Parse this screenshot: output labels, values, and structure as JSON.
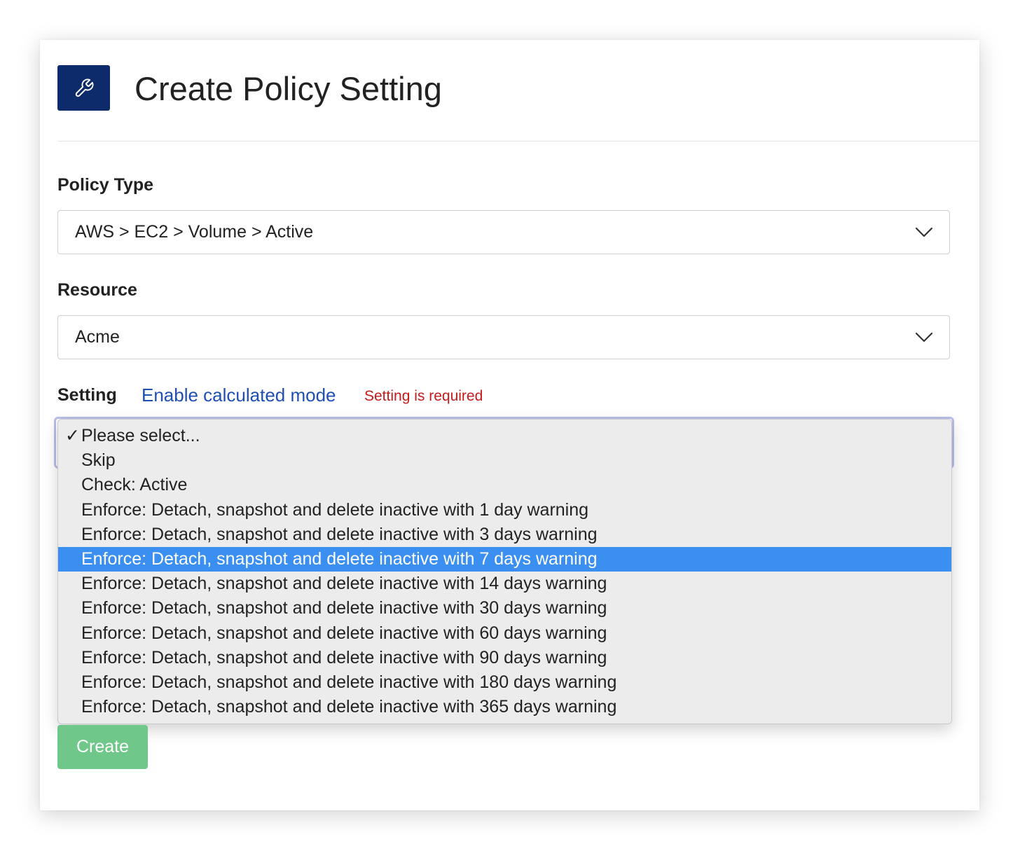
{
  "header": {
    "icon": "wrench-icon",
    "title": "Create Policy Setting"
  },
  "form": {
    "policy_type": {
      "label": "Policy Type",
      "value": "AWS > EC2 > Volume > Active"
    },
    "resource": {
      "label": "Resource",
      "value": "Acme"
    },
    "setting": {
      "label": "Setting",
      "link_label": "Enable calculated mode",
      "error_text": "Setting is required",
      "checked_option": "Please select...",
      "highlighted_option": "Enforce: Detach, snapshot and delete inactive with 7 days warning",
      "options": [
        "Please select...",
        "Skip",
        "Check: Active",
        "Enforce: Detach, snapshot and delete inactive with 1 day warning",
        "Enforce: Detach, snapshot and delete inactive with 3 days warning",
        "Enforce: Detach, snapshot and delete inactive with 7 days warning",
        "Enforce: Detach, snapshot and delete inactive with 14 days warning",
        "Enforce: Detach, snapshot and delete inactive with 30 days warning",
        "Enforce: Detach, snapshot and delete inactive with 60 days warning",
        "Enforce: Detach, snapshot and delete inactive with 90 days warning",
        "Enforce: Detach, snapshot and delete inactive with 180 days warning",
        "Enforce: Detach, snapshot and delete inactive with 365 days warning"
      ]
    },
    "create_label": "Create"
  },
  "colors": {
    "header_icon_bg": "#0d2a6b",
    "link": "#1f4fb3",
    "error": "#c41a1a",
    "highlight": "#3b8ff0",
    "create_button": "#6fc78a"
  }
}
